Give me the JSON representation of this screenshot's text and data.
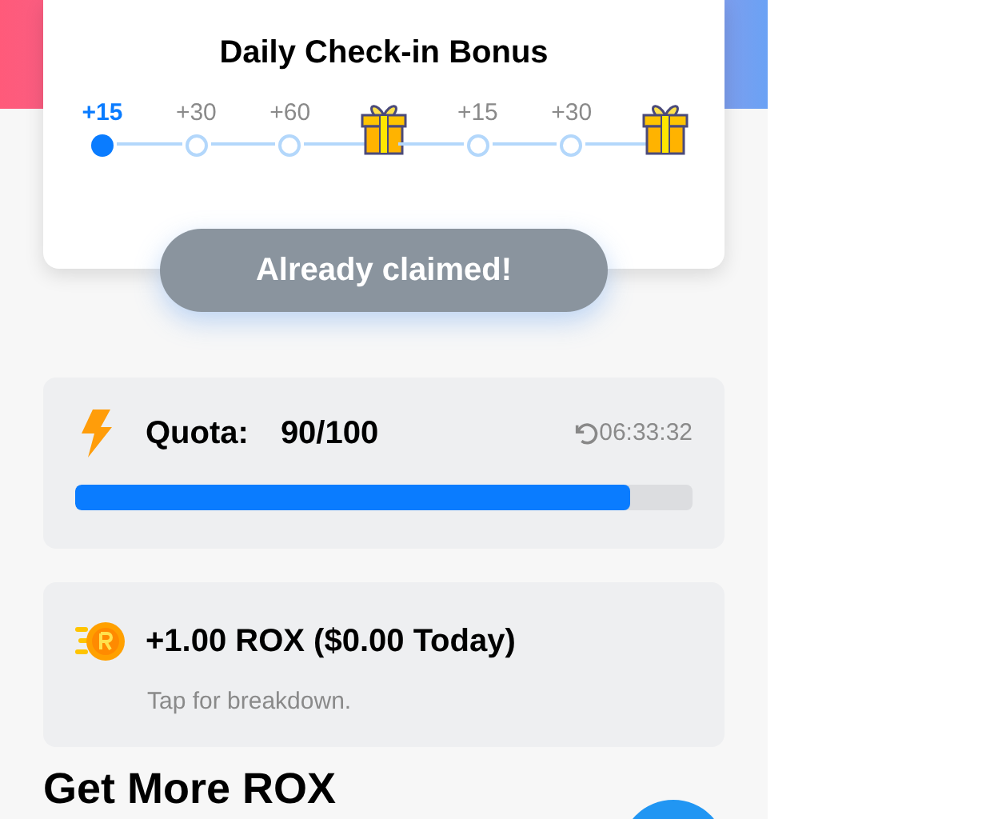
{
  "checkin": {
    "title": "Daily Check-in Bonus",
    "steps": [
      {
        "kind": "dot",
        "label": "+15",
        "selected": true
      },
      {
        "kind": "dot",
        "label": "+30",
        "selected": false
      },
      {
        "kind": "dot",
        "label": "+60",
        "selected": false
      },
      {
        "kind": "gift"
      },
      {
        "kind": "dot",
        "label": "+15",
        "selected": false
      },
      {
        "kind": "dot",
        "label": "+30",
        "selected": false
      },
      {
        "kind": "gift"
      }
    ],
    "button": {
      "label": "Already claimed!",
      "disabled": true
    }
  },
  "quota": {
    "label": "Quota:",
    "value": "90/100",
    "timer": "06:33:32",
    "level": 0.9
  },
  "reward": {
    "amount": "+1.00 ROX ($0.00 Today)",
    "hint": "Tap for breakdown."
  },
  "section_title": "Get More ROX"
}
